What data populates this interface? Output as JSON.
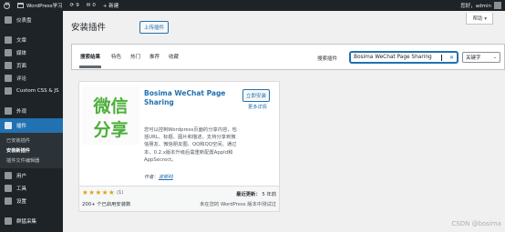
{
  "adminbar": {
    "site_name": "WordPress学习",
    "updates_count": "9",
    "comments_count": "0",
    "new_label": "+ 新建",
    "greeting": "您好，admin"
  },
  "sidebar": {
    "items": [
      {
        "label": "仪表盘",
        "icon": "dashboard-icon"
      },
      {
        "label": "文章",
        "icon": "pin-icon"
      },
      {
        "label": "媒体",
        "icon": "media-icon"
      },
      {
        "label": "页面",
        "icon": "page-icon"
      },
      {
        "label": "评论",
        "icon": "comment-icon"
      },
      {
        "label": "Custom CSS & JS",
        "icon": "code-icon"
      },
      {
        "label": "外观",
        "icon": "brush-icon"
      },
      {
        "label": "插件",
        "icon": "plugin-icon",
        "current": true
      },
      {
        "label": "用户",
        "icon": "user-icon"
      },
      {
        "label": "工具",
        "icon": "wrench-icon"
      },
      {
        "label": "设置",
        "icon": "settings-icon"
      },
      {
        "label": "群猛采集",
        "icon": "collect-icon"
      }
    ],
    "submenu": [
      "已安装插件",
      "安装新插件",
      "插件文件编辑器"
    ],
    "submenu_active": 1
  },
  "header": {
    "help_label": "帮助 ▾",
    "title": "安装插件",
    "upload_label": "上传插件"
  },
  "filters": {
    "tabs": [
      "搜索结果",
      "特色",
      "热门",
      "推荐",
      "收藏"
    ],
    "current": 0,
    "search_label": "搜索插件",
    "search_value": "Bosima WeChat Page Sharing",
    "search_type": "关键字"
  },
  "plugin": {
    "icon_text": [
      "微信",
      "分享"
    ],
    "name": "Bosima WeChat Page Sharing",
    "install_label": "立即安装",
    "details_label": "更多详情",
    "description": "您可以控制Wordpress页面的分享内容，包括URL、标题、图片和描述。支持分享到微信朋友、微信朋友圈、QQ和QQ空间。通过本，0.2.x版本升级后需重新配置AppId和AppSecrect。",
    "author_prefix": "作者：",
    "author": "波斯码",
    "rating_count": "(1)",
    "installs": "200+ 个已启用安装数",
    "updated_label": "最近更新：",
    "updated_value": "5 年前",
    "compat": "未在您的 WordPress 版本中测试过"
  },
  "watermark": "CSDN @bosima",
  "colors": {
    "admin_dark": "#1d2327",
    "accent": "#2271b1",
    "icon_green": "#4caf3a",
    "star": "#dba617"
  }
}
